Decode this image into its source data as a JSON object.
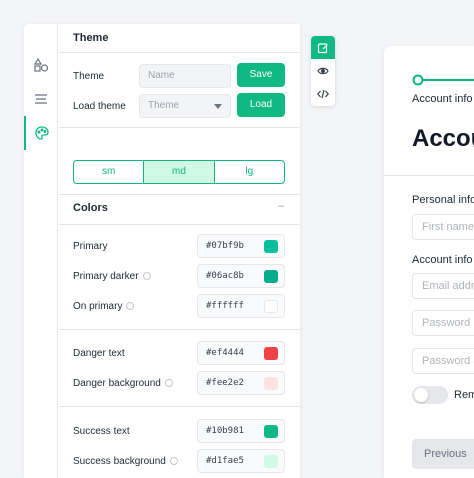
{
  "theme_panel": {
    "title": "Theme",
    "theme_label": "Theme",
    "theme_placeholder": "Name",
    "save_label": "Save",
    "load_theme_label": "Load theme",
    "load_select_placeholder": "Theme",
    "load_label": "Load",
    "sizes": [
      "sm",
      "md",
      "lg"
    ],
    "selected_size": "md"
  },
  "colors_panel": {
    "title": "Colors",
    "collapse_symbol": "–",
    "items": [
      {
        "label": "Primary",
        "value": "#07bf9b",
        "swatch": "#07bf9b",
        "info": false
      },
      {
        "label": "Primary darker",
        "value": "#06ac8b",
        "swatch": "#06ac8b",
        "info": true
      },
      {
        "label": "On primary",
        "value": "#ffffff",
        "swatch": "#ffffff",
        "info": true
      },
      {
        "label": "Danger text",
        "value": "#ef4444",
        "swatch": "#ef4444",
        "info": false
      },
      {
        "label": "Danger background",
        "value": "#fee2e2",
        "swatch": "#fee2e2",
        "info": true
      },
      {
        "label": "Success text",
        "value": "#10b981",
        "swatch": "#10b981",
        "info": false
      },
      {
        "label": "Success background",
        "value": "#d1fae5",
        "swatch": "#d1fae5",
        "info": true
      }
    ]
  },
  "preview": {
    "step_label": "Account info",
    "heading": "Account",
    "personal_info_label": "Personal info",
    "first_name_placeholder": "First name",
    "account_info_label": "Account info",
    "email_placeholder": "Email address",
    "password_placeholder": "Password",
    "password_again_placeholder": "Password again",
    "remember_label": "Remember",
    "previous_label": "Previous"
  },
  "colors": {
    "accent": "#10b981",
    "accent_light": "#d1fae5"
  }
}
